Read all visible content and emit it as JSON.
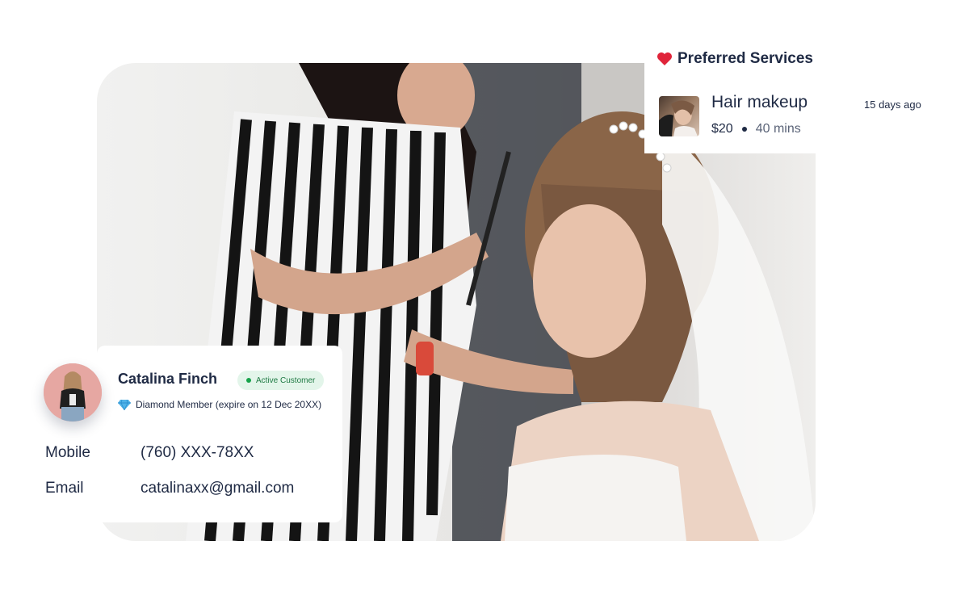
{
  "services_card": {
    "title": "Preferred Services",
    "heart_icon": "heart-icon",
    "item": {
      "name": "Hair makeup",
      "price": "$20",
      "duration": "40 mins",
      "time_ago": "15 days ago"
    }
  },
  "customer_card": {
    "name": "Catalina Finch",
    "status_badge": "Active Customer",
    "status_color": "#16a34a",
    "membership": "Diamond Member (expire on 12 Dec 20XX)",
    "membership_icon": "diamond-icon",
    "fields": {
      "mobile_label": "Mobile",
      "mobile_value": "(760) XXX-78XX",
      "email_label": "Email",
      "email_value": "catalinaxx@gmail.com"
    }
  },
  "colors": {
    "text_primary": "#1f2a44",
    "badge_bg": "#e3f5ea",
    "badge_text": "#1e7a43",
    "heart": "#e0243a"
  }
}
